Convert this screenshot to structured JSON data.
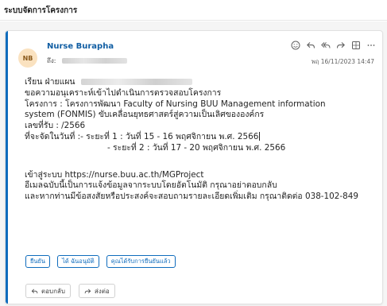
{
  "thread": {
    "title": "ระบบจัดการโครงการ"
  },
  "message": {
    "sender_initials": "NB",
    "sender_name": "Nurse Burapha",
    "to_label": "ถึง:",
    "timestamp": "พฤ 16/11/2023 14:47",
    "body": {
      "greeting": "เรียน ฝ่ายแผน",
      "line2": "ขอความอนุเคราะห์เข้าไปดำเนินการตรวจสอบโครงการ",
      "project_line1": "โครงการ : โครงการพัฒนา Faculty of Nursing BUU Management information",
      "project_line2": "system (FONMIS) ขับเคลื่อนยุทธศาสตร์สู่ความเป็นเลิศขององค์กร",
      "receipt_no": "เลขที่รับ : /2566",
      "schedule_line1": "ที่จะจัดในวันที่ :- ระยะที่ 1 : วันที่ 15 - 16 พฤศจิกายน พ.ศ. 2566",
      "schedule_line2": "- ระยะที่ 2 : วันที่ 17 - 20 พฤศจิกายน พ.ศ. 2566",
      "access_line": "เข้าสู่ระบบ https://nurse.buu.ac.th/MGProject",
      "auto_notice": "อีเมลฉบับนี้เป็นการแจ้งข้อมูลจากระบบโดยอัตโนมัติ กรุณาอย่าตอบกลับ",
      "contact_line": "และหากท่านมีข้อสงสัยหรือประสงค์จะสอบถามรายละเอียดเพิ่มเติม กรุณาติดต่อ 038-102-849"
    },
    "quick_replies": [
      "ยืนยัน",
      "ได้ ฉันอนุมัติ",
      "คุณได้รับการยืนยันแล้ว"
    ],
    "actions": {
      "reply": "ตอบกลับ",
      "forward": "ส่งต่อ"
    }
  },
  "icons": {
    "emoji": "emoji-icon",
    "reply": "reply-icon",
    "reply_all": "reply-all-icon",
    "forward": "forward-icon",
    "apps": "apps-icon",
    "more": "more-icon"
  },
  "colors": {
    "accent": "#0f6cbd",
    "sender": "#115ea3",
    "avatar_bg": "#fae2c0"
  }
}
